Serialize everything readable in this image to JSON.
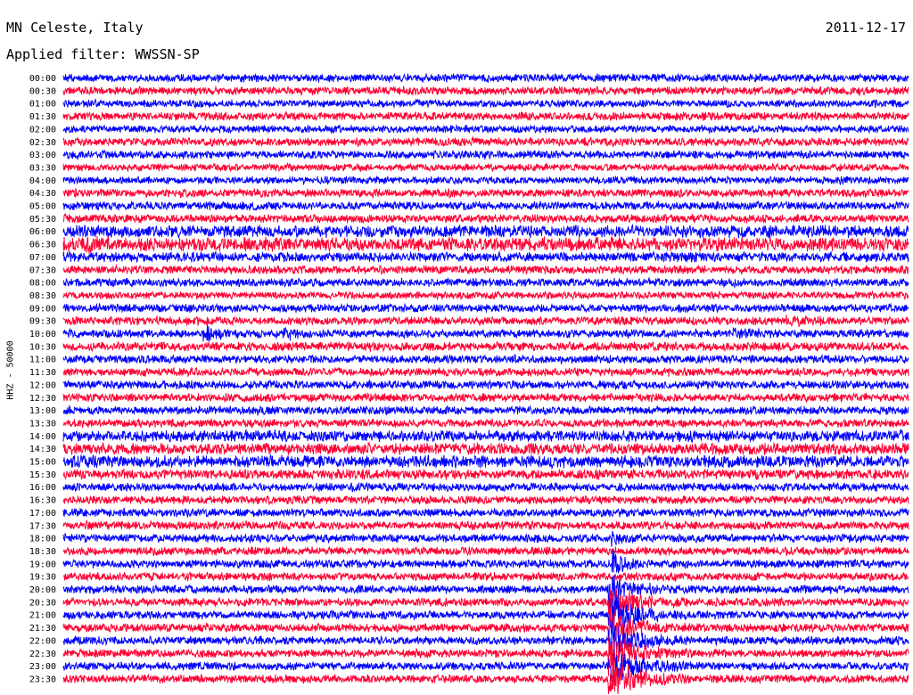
{
  "header": {
    "station": "MN Celeste, Italy",
    "date": "2011-12-17",
    "filter": "Applied filter: WWSSN-SP"
  },
  "chart_data": {
    "type": "line",
    "ylabel": "HHZ - 50000",
    "x_range_minutes": [
      0,
      30
    ],
    "colors": [
      "#0000ff",
      "#ff0033"
    ],
    "rows": [
      "00:00",
      "00:30",
      "01:00",
      "01:30",
      "02:00",
      "02:30",
      "03:00",
      "03:30",
      "04:00",
      "04:30",
      "05:00",
      "05:30",
      "06:00",
      "06:30",
      "07:00",
      "07:30",
      "08:00",
      "08:30",
      "09:00",
      "09:30",
      "10:00",
      "10:30",
      "11:00",
      "11:30",
      "12:00",
      "12:30",
      "13:00",
      "13:30",
      "14:00",
      "14:30",
      "15:00",
      "15:30",
      "16:00",
      "16:30",
      "17:00",
      "17:30",
      "18:00",
      "18:30",
      "19:00",
      "19:30",
      "20:00",
      "20:30",
      "21:00",
      "21:30",
      "22:00",
      "22:30",
      "23:00",
      "23:30"
    ],
    "noise_level": [
      1.0,
      1.0,
      0.9,
      1.0,
      0.9,
      1.0,
      1.0,
      0.9,
      0.9,
      1.0,
      1.0,
      1.0,
      1.5,
      1.7,
      1.2,
      1.0,
      1.0,
      0.9,
      1.0,
      1.0,
      1.0,
      1.1,
      1.0,
      1.0,
      1.0,
      1.0,
      1.0,
      1.0,
      1.4,
      1.4,
      1.5,
      1.2,
      1.0,
      1.0,
      1.0,
      1.0,
      1.0,
      1.0,
      1.0,
      1.0,
      1.0,
      1.0,
      1.0,
      1.0,
      1.0,
      1.0,
      1.0,
      1.0
    ],
    "events": [
      {
        "row": "06:30",
        "minute": 0.8,
        "amplitude": 2.2,
        "duration": 0.4
      },
      {
        "row": "10:00",
        "minute": 5.0,
        "amplitude": 2.2,
        "duration": 1.0
      },
      {
        "row": "10:00",
        "minute": 7.8,
        "amplitude": 2.0,
        "duration": 0.8
      },
      {
        "row": "10:00",
        "minute": 23.8,
        "amplitude": 1.6,
        "duration": 1.2
      },
      {
        "row": "09:30",
        "minute": 25.7,
        "amplitude": 1.8,
        "duration": 0.8
      },
      {
        "row": "17:30",
        "minute": 4.5,
        "amplitude": 1.3,
        "duration": 1.5
      },
      {
        "row": "18:00",
        "minute": 19.5,
        "amplitude": 2.5,
        "duration": 0.3
      },
      {
        "row": "19:00",
        "minute": 19.5,
        "amplitude": 4.0,
        "duration": 0.5
      },
      {
        "row": "20:00",
        "minute": 19.4,
        "amplitude": 5.0,
        "duration": 1.0
      },
      {
        "row": "20:30",
        "minute": 19.4,
        "amplitude": 6.0,
        "duration": 1.1
      },
      {
        "row": "21:00",
        "minute": 19.4,
        "amplitude": 6.0,
        "duration": 1.1
      },
      {
        "row": "21:30",
        "minute": 19.4,
        "amplitude": 6.0,
        "duration": 1.1
      },
      {
        "row": "22:00",
        "minute": 19.4,
        "amplitude": 6.0,
        "duration": 1.1
      },
      {
        "row": "22:30",
        "minute": 19.4,
        "amplitude": 6.0,
        "duration": 1.2
      },
      {
        "row": "23:00",
        "minute": 19.4,
        "amplitude": 6.0,
        "duration": 1.2
      },
      {
        "row": "23:30",
        "minute": 19.4,
        "amplitude": 6.0,
        "duration": 1.2
      }
    ]
  }
}
